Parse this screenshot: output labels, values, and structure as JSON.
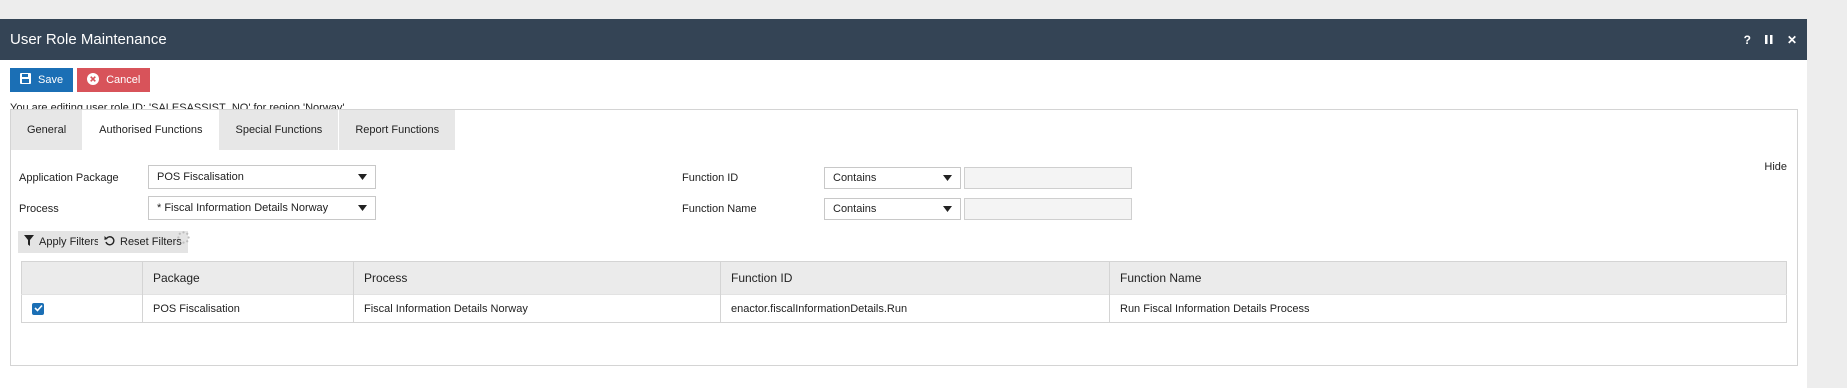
{
  "window": {
    "title": "User Role Maintenance",
    "controls": {
      "help": "?",
      "pause": "II",
      "close": "✕"
    }
  },
  "toolbar": {
    "save_label": "Save",
    "cancel_label": "Cancel"
  },
  "info_text": "You are editing user role ID: 'SALESASSIST_NO' for region 'Norway'",
  "tabs": [
    {
      "label": "General",
      "active": false
    },
    {
      "label": "Authorised Functions",
      "active": true
    },
    {
      "label": "Special Functions",
      "active": false
    },
    {
      "label": "Report Functions",
      "active": false
    }
  ],
  "filters": {
    "application_package": {
      "label": "Application Package",
      "value": "POS Fiscalisation"
    },
    "process": {
      "label": "Process",
      "value": "* Fiscal Information Details Norway"
    },
    "function_id": {
      "label": "Function ID",
      "operator": "Contains",
      "value": ""
    },
    "function_name": {
      "label": "Function Name",
      "operator": "Contains",
      "value": ""
    },
    "hide_label": "Hide",
    "apply_label": "Apply Filters",
    "reset_label": "Reset Filters"
  },
  "table": {
    "columns": [
      "",
      "Package",
      "Process",
      "Function ID",
      "Function Name"
    ],
    "rows": [
      {
        "checked": true,
        "package": "POS Fiscalisation",
        "process": "Fiscal Information Details Norway",
        "function_id": "enactor.fiscalInformationDetails.Run",
        "function_name": "Run Fiscal Information Details Process"
      }
    ]
  },
  "colors": {
    "titlebar": "#344455",
    "save": "#1b6fb5",
    "cancel": "#d8535a"
  },
  "icons": {
    "save": "floppy-disk-icon",
    "cancel": "x-circle-icon",
    "dropdown": "caret-down-icon",
    "apply": "funnel-icon",
    "reset": "undo-icon",
    "loading": "spinner-icon",
    "checkbox": "checkmark-icon"
  }
}
